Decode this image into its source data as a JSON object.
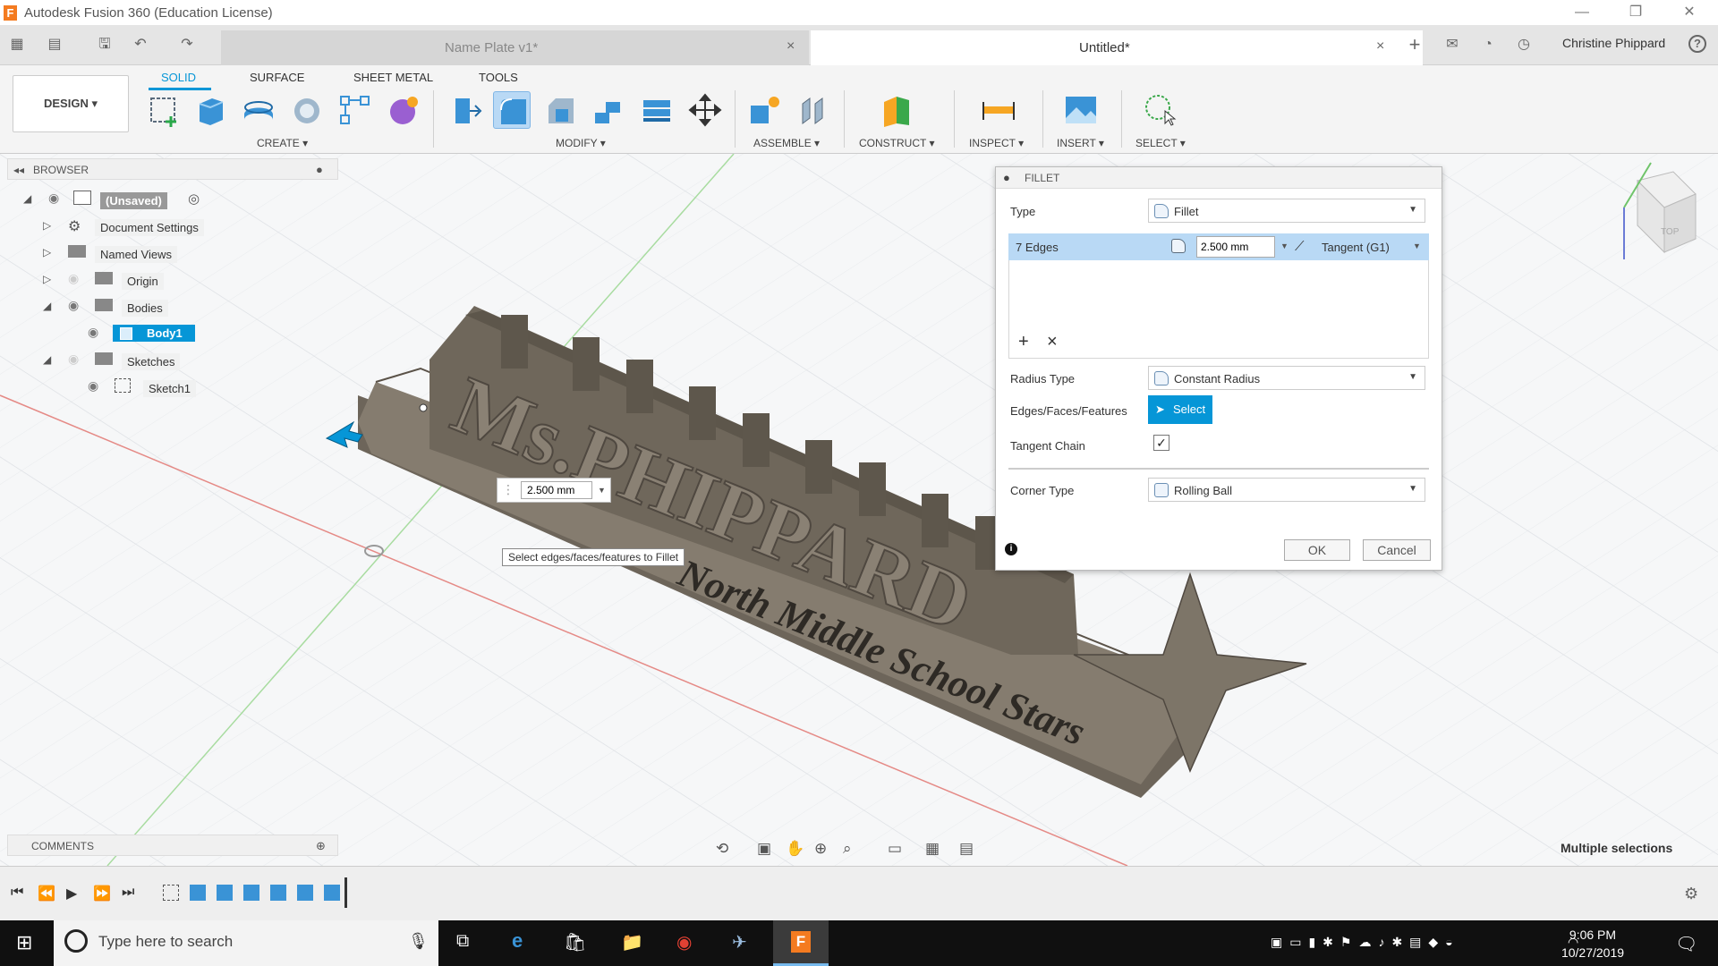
{
  "window": {
    "title": "Autodesk Fusion 360 (Education License)",
    "logo_letter": "F",
    "min": "—",
    "restore": "❐",
    "close": "✕"
  },
  "tabs": [
    {
      "label": "Name Plate v1*",
      "active": false
    },
    {
      "label": "Untitled*",
      "active": true
    }
  ],
  "tab_close": "×",
  "user": "Christine Phippard",
  "help": "?",
  "ribbon": {
    "workspace": "DESIGN ▾",
    "tabs": [
      "SOLID",
      "SURFACE",
      "SHEET METAL",
      "TOOLS"
    ],
    "groups": [
      "CREATE ▾",
      "MODIFY ▾",
      "ASSEMBLE ▾",
      "CONSTRUCT ▾",
      "INSPECT ▾",
      "INSERT ▾",
      "SELECT ▾"
    ]
  },
  "browser": {
    "title": "BROWSER",
    "items": [
      {
        "label": "(Unsaved)"
      },
      {
        "label": "Document Settings"
      },
      {
        "label": "Named Views"
      },
      {
        "label": "Origin"
      },
      {
        "label": "Bodies"
      },
      {
        "label": "Body1"
      },
      {
        "label": "Sketches"
      },
      {
        "label": "Sketch1"
      }
    ]
  },
  "comments": {
    "title": "COMMENTS"
  },
  "fillet": {
    "title": "FILLET",
    "type_label": "Type",
    "type_value": "Fillet",
    "edges_label": "7 Edges",
    "radius_value": "2.500 mm",
    "continuity": "Tangent (G1)",
    "add": "+",
    "remove": "×",
    "radius_type_label": "Radius Type",
    "radius_type_value": "Constant Radius",
    "eff_label": "Edges/Faces/Features",
    "select_label": "Select",
    "tangent_chain_label": "Tangent Chain",
    "tangent_chain": true,
    "corner_type_label": "Corner Type",
    "corner_type_value": "Rolling Ball",
    "ok": "OK",
    "cancel": "Cancel"
  },
  "viewport": {
    "dimension_value": "2.500 mm",
    "tooltip": "Select edges/faces/features to Fillet",
    "status": "Multiple selections",
    "model_main_text": "Ms.PHIPPARD",
    "model_sub_text": "North Middle School Stars",
    "viewcube_face": "TOP"
  },
  "taskbar": {
    "search_placeholder": "Type here to search",
    "time": "9:06 PM",
    "date": "10/27/2019"
  },
  "colors": {
    "accent": "#0696d7",
    "model": "#7e7567",
    "app_logo": "#f47b20"
  }
}
